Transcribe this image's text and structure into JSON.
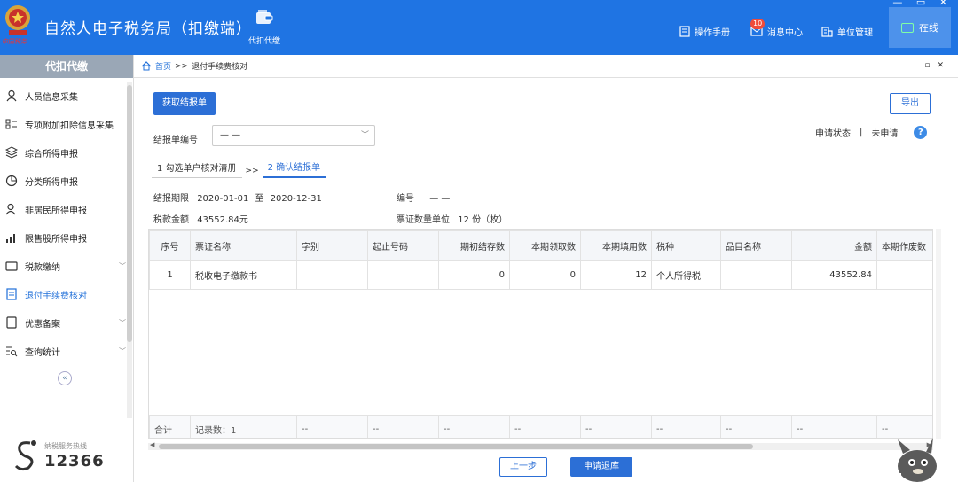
{
  "header": {
    "logo_sub": "中国税务",
    "app_title": "自然人电子税务局（扣缴端）",
    "module_label": "代扣代缴",
    "manual": "操作手册",
    "messages": "消息中心",
    "message_count": "10",
    "unit_manage": "单位管理",
    "online": "在线",
    "colors": {
      "brand": "#1f74e3",
      "online_bg": "#4d92eb"
    }
  },
  "sidebar": {
    "title": "代扣代缴",
    "items": [
      {
        "label": "人员信息采集",
        "icon": "person-icon"
      },
      {
        "label": "专项附加扣除信息采集",
        "icon": "list-icon"
      },
      {
        "label": "综合所得申报",
        "icon": "layers-icon"
      },
      {
        "label": "分类所得申报",
        "icon": "pie-icon"
      },
      {
        "label": "非居民所得申报",
        "icon": "person-icon"
      },
      {
        "label": "限售股所得申报",
        "icon": "bars-icon"
      },
      {
        "label": "税款缴纳",
        "icon": "folder-icon"
      },
      {
        "label": "退付手续费核对",
        "icon": "doc-icon"
      },
      {
        "label": "优惠备案",
        "icon": "file-icon"
      },
      {
        "label": "查询统计",
        "icon": "search-list-icon"
      }
    ],
    "collapse": "«",
    "hotline_label": "纳税服务热线",
    "hotline_number": "12366"
  },
  "breadcrumb": {
    "home": "首页",
    "sep": ">>",
    "current": "退付手续费核对"
  },
  "main": {
    "fetch_button": "获取结报单",
    "export_button": "导出",
    "status_label": "申请状态",
    "status_sep": "|",
    "status_value": "未申请",
    "help": "?",
    "report_no_label": "结报单编号",
    "report_no_value": "— —",
    "step1": "1 勾选单户核对清册",
    "step_sep": ">>",
    "step2": "2 确认结报单",
    "period_label": "结报期限",
    "period_from": "2020-01-01",
    "period_to_word": "至",
    "period_to": "2020-12-31",
    "serial_label": "编号",
    "serial_value": "— —",
    "amount_label": "税款金额",
    "amount_value": "43552.84元",
    "unit_label": "票证数量单位",
    "unit_value": "12 份（枚）",
    "prev_button": "上一步",
    "apply_button": "申请退库"
  },
  "table": {
    "headers": [
      "序号",
      "票证名称",
      "字别",
      "起止号码",
      "期初结存数",
      "本期领取数",
      "本期填用数",
      "税种",
      "品目名称",
      "金额",
      "本期作废数"
    ],
    "rows": [
      [
        "1",
        "税收电子缴款书",
        "",
        "",
        "0",
        "0",
        "12",
        "个人所得税",
        "",
        "43552.84",
        ""
      ]
    ],
    "footer": [
      "合计",
      "记录数：1",
      "--",
      "--",
      "--",
      "--",
      "--",
      "--",
      "--",
      "--",
      "--"
    ]
  }
}
